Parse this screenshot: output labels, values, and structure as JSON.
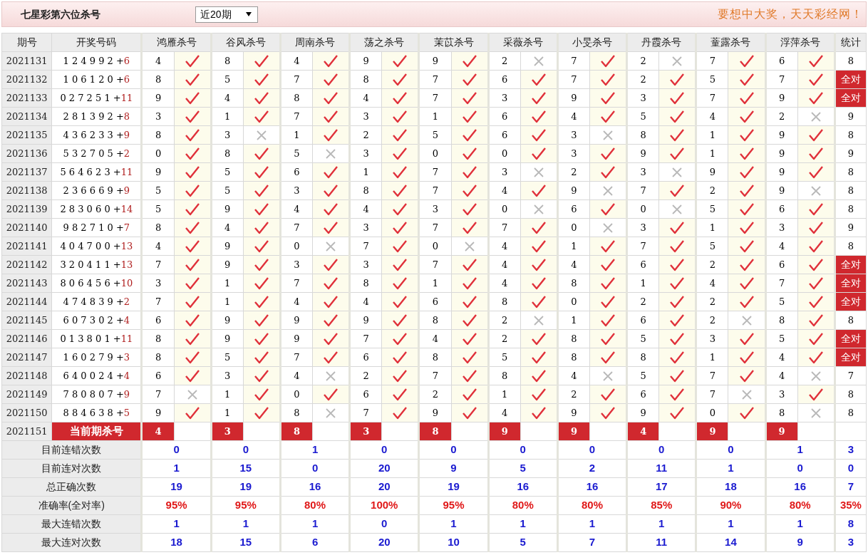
{
  "header": {
    "title": "七星彩第六位杀号",
    "period_select": "近20期",
    "slogan": "要想中大奖，天天彩经网！"
  },
  "columns": {
    "period": "期号",
    "draw": "开奖号码",
    "pickers": [
      "鸿雁杀号",
      "谷风杀号",
      "周南杀号",
      "荡之杀号",
      "茉苡杀号",
      "采薇杀号",
      "小旻杀号",
      "丹霞杀号",
      "蕫露杀号",
      "浮萍杀号"
    ],
    "stat": "统计"
  },
  "rows": [
    {
      "period": "2021131",
      "numbers": "1 2 4 9 9 2 +",
      "extra": "6",
      "picks": [
        [
          "4",
          true
        ],
        [
          "8",
          true
        ],
        [
          "4",
          true
        ],
        [
          "9",
          true
        ],
        [
          "9",
          true
        ],
        [
          "2",
          false
        ],
        [
          "7",
          true
        ],
        [
          "2",
          false
        ],
        [
          "7",
          true
        ],
        [
          "6",
          true
        ]
      ],
      "stat": "8",
      "all_correct": false
    },
    {
      "period": "2021132",
      "numbers": "1 0 6 1 2 0 +",
      "extra": "6",
      "picks": [
        [
          "8",
          true
        ],
        [
          "5",
          true
        ],
        [
          "7",
          true
        ],
        [
          "8",
          true
        ],
        [
          "7",
          true
        ],
        [
          "6",
          true
        ],
        [
          "7",
          true
        ],
        [
          "2",
          true
        ],
        [
          "5",
          true
        ],
        [
          "7",
          true
        ]
      ],
      "stat": "全对",
      "all_correct": true
    },
    {
      "period": "2021133",
      "numbers": "0 2 7 2 5 1 +",
      "extra": "11",
      "picks": [
        [
          "9",
          true
        ],
        [
          "4",
          true
        ],
        [
          "8",
          true
        ],
        [
          "4",
          true
        ],
        [
          "7",
          true
        ],
        [
          "3",
          true
        ],
        [
          "9",
          true
        ],
        [
          "3",
          true
        ],
        [
          "7",
          true
        ],
        [
          "9",
          true
        ]
      ],
      "stat": "全对",
      "all_correct": true
    },
    {
      "period": "2021134",
      "numbers": "2 8 1 3 9 2 +",
      "extra": "8",
      "picks": [
        [
          "3",
          true
        ],
        [
          "1",
          true
        ],
        [
          "7",
          true
        ],
        [
          "3",
          true
        ],
        [
          "1",
          true
        ],
        [
          "6",
          true
        ],
        [
          "4",
          true
        ],
        [
          "5",
          true
        ],
        [
          "4",
          true
        ],
        [
          "2",
          false
        ]
      ],
      "stat": "9",
      "all_correct": false
    },
    {
      "period": "2021135",
      "numbers": "4 3 6 2 3 3 +",
      "extra": "9",
      "picks": [
        [
          "8",
          true
        ],
        [
          "3",
          false
        ],
        [
          "1",
          true
        ],
        [
          "2",
          true
        ],
        [
          "5",
          true
        ],
        [
          "6",
          true
        ],
        [
          "3",
          false
        ],
        [
          "8",
          true
        ],
        [
          "1",
          true
        ],
        [
          "9",
          true
        ]
      ],
      "stat": "8",
      "all_correct": false
    },
    {
      "period": "2021136",
      "numbers": "5 3 2 7 0 5 +",
      "extra": "2",
      "picks": [
        [
          "0",
          true
        ],
        [
          "8",
          true
        ],
        [
          "5",
          false
        ],
        [
          "3",
          true
        ],
        [
          "0",
          true
        ],
        [
          "0",
          true
        ],
        [
          "3",
          true
        ],
        [
          "9",
          true
        ],
        [
          "1",
          true
        ],
        [
          "9",
          true
        ]
      ],
      "stat": "9",
      "all_correct": false
    },
    {
      "period": "2021137",
      "numbers": "5 6 4 6 2 3 +",
      "extra": "11",
      "picks": [
        [
          "9",
          true
        ],
        [
          "5",
          true
        ],
        [
          "6",
          true
        ],
        [
          "1",
          true
        ],
        [
          "7",
          true
        ],
        [
          "3",
          false
        ],
        [
          "2",
          true
        ],
        [
          "3",
          false
        ],
        [
          "9",
          true
        ],
        [
          "9",
          true
        ]
      ],
      "stat": "8",
      "all_correct": false
    },
    {
      "period": "2021138",
      "numbers": "2 3 6 6 6 9 +",
      "extra": "9",
      "picks": [
        [
          "5",
          true
        ],
        [
          "5",
          true
        ],
        [
          "3",
          true
        ],
        [
          "8",
          true
        ],
        [
          "7",
          true
        ],
        [
          "4",
          true
        ],
        [
          "9",
          false
        ],
        [
          "7",
          true
        ],
        [
          "2",
          true
        ],
        [
          "9",
          false
        ]
      ],
      "stat": "8",
      "all_correct": false
    },
    {
      "period": "2021139",
      "numbers": "2 8 3 0 6 0 +",
      "extra": "14",
      "picks": [
        [
          "5",
          true
        ],
        [
          "9",
          true
        ],
        [
          "4",
          true
        ],
        [
          "4",
          true
        ],
        [
          "3",
          true
        ],
        [
          "0",
          false
        ],
        [
          "6",
          true
        ],
        [
          "0",
          false
        ],
        [
          "5",
          true
        ],
        [
          "6",
          true
        ]
      ],
      "stat": "8",
      "all_correct": false
    },
    {
      "period": "2021140",
      "numbers": "9 8 2 7 1 0 +",
      "extra": "7",
      "picks": [
        [
          "8",
          true
        ],
        [
          "4",
          true
        ],
        [
          "7",
          true
        ],
        [
          "3",
          true
        ],
        [
          "7",
          true
        ],
        [
          "7",
          true
        ],
        [
          "0",
          false
        ],
        [
          "3",
          true
        ],
        [
          "1",
          true
        ],
        [
          "3",
          true
        ]
      ],
      "stat": "9",
      "all_correct": false
    },
    {
      "period": "2021141",
      "numbers": "4 0 4 7 0 0 +",
      "extra": "13",
      "picks": [
        [
          "4",
          true
        ],
        [
          "9",
          true
        ],
        [
          "0",
          false
        ],
        [
          "7",
          true
        ],
        [
          "0",
          false
        ],
        [
          "4",
          true
        ],
        [
          "1",
          true
        ],
        [
          "7",
          true
        ],
        [
          "5",
          true
        ],
        [
          "4",
          true
        ]
      ],
      "stat": "8",
      "all_correct": false
    },
    {
      "period": "2021142",
      "numbers": "3 2 0 4 1 1 +",
      "extra": "13",
      "picks": [
        [
          "7",
          true
        ],
        [
          "9",
          true
        ],
        [
          "3",
          true
        ],
        [
          "3",
          true
        ],
        [
          "7",
          true
        ],
        [
          "4",
          true
        ],
        [
          "4",
          true
        ],
        [
          "6",
          true
        ],
        [
          "2",
          true
        ],
        [
          "6",
          true
        ]
      ],
      "stat": "全对",
      "all_correct": true
    },
    {
      "period": "2021143",
      "numbers": "8 0 6 4 5 6 +",
      "extra": "10",
      "picks": [
        [
          "3",
          true
        ],
        [
          "1",
          true
        ],
        [
          "7",
          true
        ],
        [
          "8",
          true
        ],
        [
          "1",
          true
        ],
        [
          "4",
          true
        ],
        [
          "8",
          true
        ],
        [
          "1",
          true
        ],
        [
          "4",
          true
        ],
        [
          "7",
          true
        ]
      ],
      "stat": "全对",
      "all_correct": true
    },
    {
      "period": "2021144",
      "numbers": "4 7 4 8 3 9 +",
      "extra": "2",
      "picks": [
        [
          "7",
          true
        ],
        [
          "1",
          true
        ],
        [
          "4",
          true
        ],
        [
          "4",
          true
        ],
        [
          "6",
          true
        ],
        [
          "8",
          true
        ],
        [
          "0",
          true
        ],
        [
          "2",
          true
        ],
        [
          "2",
          true
        ],
        [
          "5",
          true
        ]
      ],
      "stat": "全对",
      "all_correct": true
    },
    {
      "period": "2021145",
      "numbers": "6 0 7 3 0 2 +",
      "extra": "4",
      "picks": [
        [
          "6",
          true
        ],
        [
          "9",
          true
        ],
        [
          "9",
          true
        ],
        [
          "9",
          true
        ],
        [
          "8",
          true
        ],
        [
          "2",
          false
        ],
        [
          "1",
          true
        ],
        [
          "6",
          true
        ],
        [
          "2",
          false
        ],
        [
          "8",
          true
        ]
      ],
      "stat": "8",
      "all_correct": false
    },
    {
      "period": "2021146",
      "numbers": "0 1 3 8 0 1 +",
      "extra": "11",
      "picks": [
        [
          "8",
          true
        ],
        [
          "9",
          true
        ],
        [
          "9",
          true
        ],
        [
          "7",
          true
        ],
        [
          "4",
          true
        ],
        [
          "2",
          true
        ],
        [
          "8",
          true
        ],
        [
          "5",
          true
        ],
        [
          "3",
          true
        ],
        [
          "5",
          true
        ]
      ],
      "stat": "全对",
      "all_correct": true
    },
    {
      "period": "2021147",
      "numbers": "1 6 0 2 7 9 +",
      "extra": "3",
      "picks": [
        [
          "8",
          true
        ],
        [
          "5",
          true
        ],
        [
          "7",
          true
        ],
        [
          "6",
          true
        ],
        [
          "8",
          true
        ],
        [
          "5",
          true
        ],
        [
          "8",
          true
        ],
        [
          "8",
          true
        ],
        [
          "1",
          true
        ],
        [
          "4",
          true
        ]
      ],
      "stat": "全对",
      "all_correct": true
    },
    {
      "period": "2021148",
      "numbers": "6 4 0 0 2 4 +",
      "extra": "4",
      "picks": [
        [
          "6",
          true
        ],
        [
          "3",
          true
        ],
        [
          "4",
          false
        ],
        [
          "2",
          true
        ],
        [
          "7",
          true
        ],
        [
          "8",
          true
        ],
        [
          "4",
          false
        ],
        [
          "5",
          true
        ],
        [
          "7",
          true
        ],
        [
          "4",
          false
        ]
      ],
      "stat": "7",
      "all_correct": false
    },
    {
      "period": "2021149",
      "numbers": "7 8 0 8 0 7 +",
      "extra": "9",
      "picks": [
        [
          "7",
          false
        ],
        [
          "1",
          true
        ],
        [
          "0",
          true
        ],
        [
          "6",
          true
        ],
        [
          "2",
          true
        ],
        [
          "1",
          true
        ],
        [
          "2",
          true
        ],
        [
          "6",
          true
        ],
        [
          "7",
          false
        ],
        [
          "3",
          true
        ]
      ],
      "stat": "8",
      "all_correct": false
    },
    {
      "period": "2021150",
      "numbers": "8 8 4 6 3 8 +",
      "extra": "5",
      "picks": [
        [
          "9",
          true
        ],
        [
          "1",
          true
        ],
        [
          "8",
          false
        ],
        [
          "7",
          true
        ],
        [
          "9",
          true
        ],
        [
          "4",
          true
        ],
        [
          "9",
          true
        ],
        [
          "9",
          true
        ],
        [
          "0",
          true
        ],
        [
          "8",
          false
        ]
      ],
      "stat": "8",
      "all_correct": false
    }
  ],
  "current": {
    "period": "2021151",
    "label": "当前期杀号",
    "picks": [
      "4",
      "3",
      "8",
      "3",
      "8",
      "9",
      "9",
      "4",
      "9",
      "9"
    ]
  },
  "stats": [
    {
      "label": "目前连错次数",
      "kind": "count",
      "values": [
        "0",
        "0",
        "1",
        "0",
        "0",
        "0",
        "0",
        "0",
        "0",
        "1"
      ],
      "total": "3"
    },
    {
      "label": "目前连对次数",
      "kind": "count",
      "values": [
        "1",
        "15",
        "0",
        "20",
        "9",
        "5",
        "2",
        "11",
        "1",
        "0"
      ],
      "total": "0"
    },
    {
      "label": "总正确次数",
      "kind": "count",
      "values": [
        "19",
        "19",
        "16",
        "20",
        "19",
        "16",
        "16",
        "17",
        "18",
        "16"
      ],
      "total": "7"
    },
    {
      "label": "准确率(全对率)",
      "kind": "percent",
      "values": [
        "95%",
        "95%",
        "80%",
        "100%",
        "95%",
        "80%",
        "80%",
        "85%",
        "90%",
        "80%"
      ],
      "total": "35%"
    },
    {
      "label": "最大连错次数",
      "kind": "count",
      "values": [
        "1",
        "1",
        "1",
        "0",
        "1",
        "1",
        "1",
        "1",
        "1",
        "1"
      ],
      "total": "8"
    },
    {
      "label": "最大连对次数",
      "kind": "count",
      "values": [
        "18",
        "15",
        "6",
        "20",
        "10",
        "5",
        "7",
        "11",
        "14",
        "9"
      ],
      "total": "3"
    }
  ]
}
